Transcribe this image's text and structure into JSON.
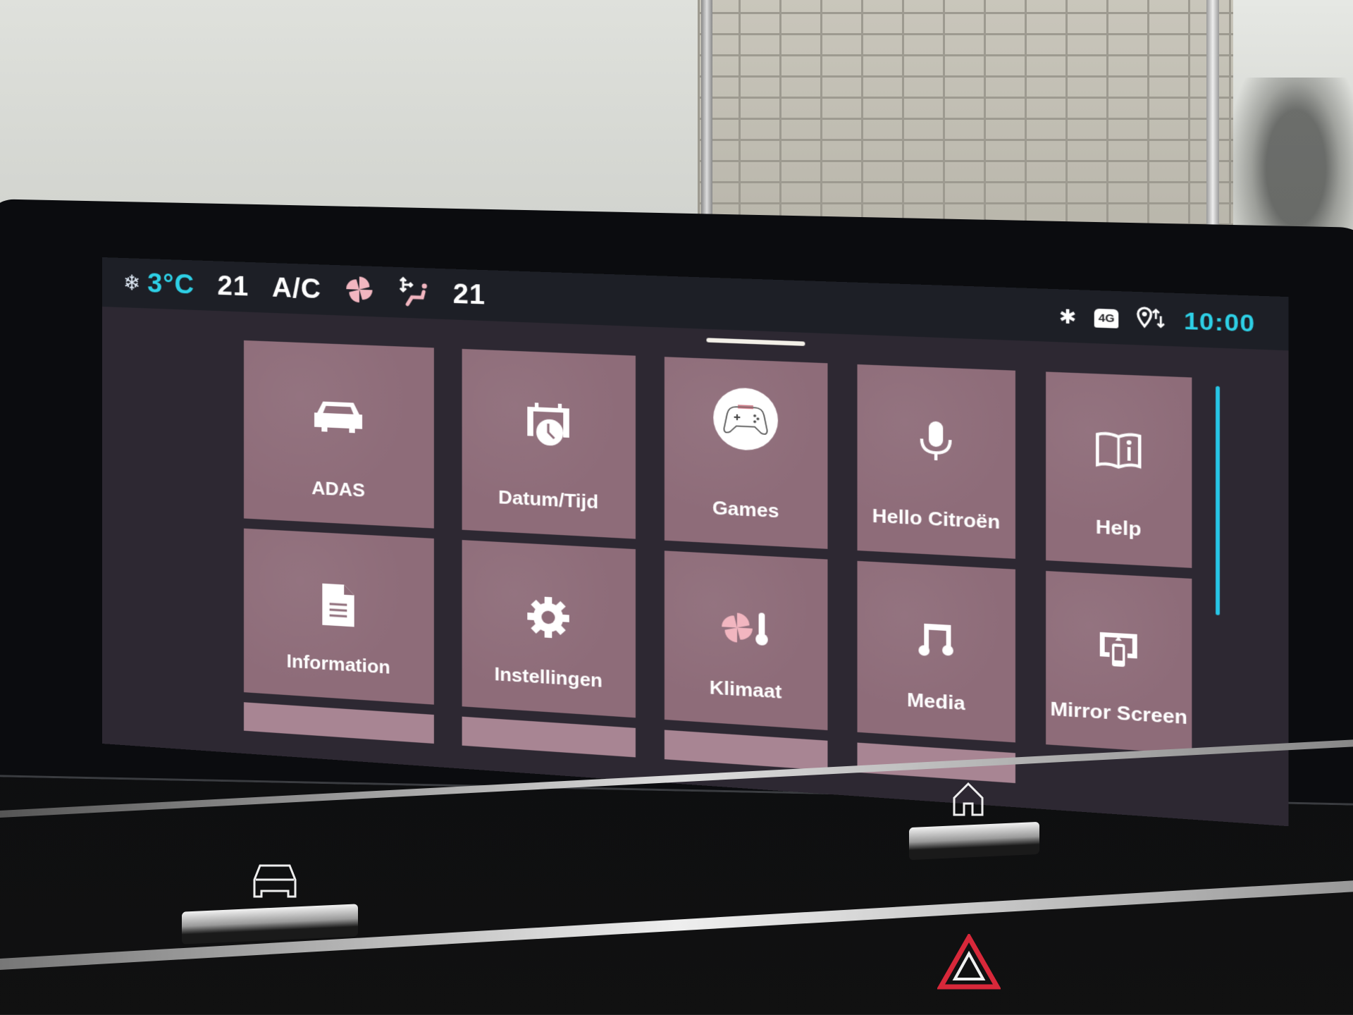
{
  "status_bar": {
    "outside_temp": "3°C",
    "outside_icon": "snowflake-icon",
    "driver_temp": "21",
    "ac_label": "A/C",
    "fan_icon": "fan-icon",
    "airflow_icon": "seat-airflow-icon",
    "passenger_temp": "21",
    "right_icons": [
      "bluetooth-icon",
      "4g-icon",
      "location-data-icon"
    ],
    "network_badge": "4G",
    "clock": "10:00"
  },
  "page_indicator": {
    "current_page": 1
  },
  "tiles": [
    {
      "label": "ADAS",
      "icon": "car-icon"
    },
    {
      "label": "Datum/Tijd",
      "icon": "calendar-clock-icon"
    },
    {
      "label": "Games",
      "icon": "gamepad-icon"
    },
    {
      "label": "Hello Citroën",
      "icon": "microphone-icon"
    },
    {
      "label": "Help",
      "icon": "book-info-icon"
    },
    {
      "label": "Information",
      "icon": "document-icon"
    },
    {
      "label": "Instellingen",
      "icon": "gear-icon"
    },
    {
      "label": "Klimaat",
      "icon": "fan-thermometer-icon"
    },
    {
      "label": "Media",
      "icon": "music-note-icon"
    },
    {
      "label": "Mirror Screen",
      "icon": "mirror-screen-icon"
    }
  ],
  "hardware": {
    "left_button_icon": "vehicle-icon",
    "right_button_icon": "home-icon",
    "hazard_icon": "hazard-icon"
  },
  "colors": {
    "accent_cyan": "#2ed0e6",
    "tile": "#8e6c79",
    "screen_bg": "#2d2832",
    "statusbar_bg": "#1d1f26",
    "fan_pink": "#f2b6c0"
  }
}
